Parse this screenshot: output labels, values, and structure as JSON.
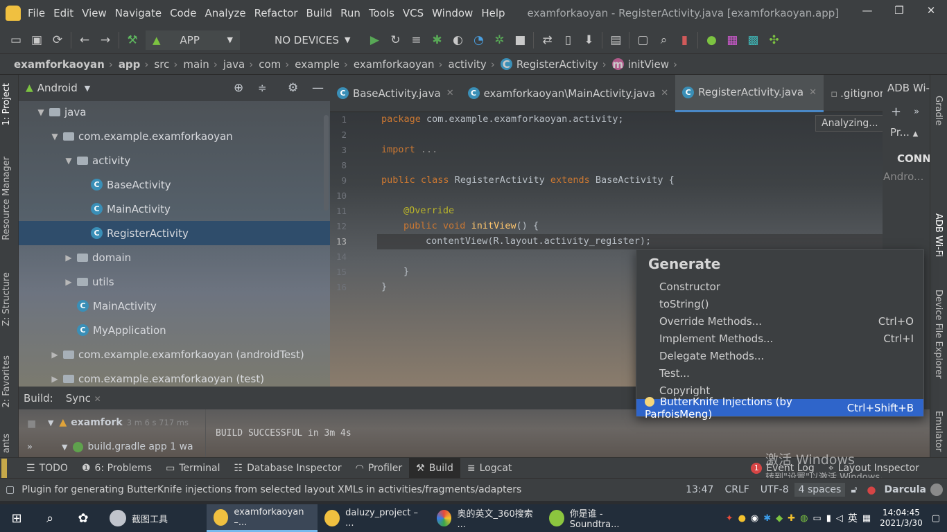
{
  "menu": [
    "File",
    "Edit",
    "View",
    "Navigate",
    "Code",
    "Analyze",
    "Refactor",
    "Build",
    "Run",
    "Tools",
    "VCS",
    "Window",
    "Help"
  ],
  "window_title": "examforkaoyan - RegisterActivity.java [examforkaoyan.app]",
  "toolbar": {
    "config": "APP",
    "devices": "NO DEVICES"
  },
  "breadcrumb": [
    "examforkaoyan",
    "app",
    "src",
    "main",
    "java",
    "com",
    "example",
    "examforkaoyan",
    "activity",
    "RegisterActivity",
    "initView"
  ],
  "left_tabs": [
    "1: Project",
    "Resource Manager",
    "Z: Structure",
    "2: Favorites",
    "ants"
  ],
  "right_tabs": [
    "Gradle",
    "ADB Wi-Fi",
    "Device File Explorer",
    "Emulator"
  ],
  "project": {
    "title": "Android",
    "rows": [
      "java",
      "com.example.examforkaoyan",
      "activity",
      "BaseActivity",
      "MainActivity",
      "RegisterActivity",
      "domain",
      "utils",
      "MainActivity",
      "MyApplication",
      "com.example.examforkaoyan (androidTest)",
      "com.example.examforkaoyan (test)"
    ]
  },
  "tabs": [
    "BaseActivity.java",
    "examforkaoyan\\MainActivity.java",
    "RegisterActivity.java",
    ".gitignore"
  ],
  "side_panel": {
    "title": "ADB Wi-",
    "btn": "Pr...",
    "conn": "CONN",
    "android": "Andro..."
  },
  "analyzing": "Analyzing...",
  "line_numbers": [
    "1",
    "2",
    "3",
    "8",
    "9",
    "10",
    "11",
    "12",
    "13",
    "14",
    "15",
    "16"
  ],
  "code": {
    "l1_kw": "package",
    "l1": " com.example.examforkaoyan.activity;",
    "l3_kw": "import",
    "l3": " ...",
    "l9_kw1": "public",
    "l9_kw2": "class",
    "l9_a": " RegisterActivity ",
    "l9_kw3": "extends",
    "l9_b": " BaseActivity {",
    "l11": "@Override",
    "l12_kw1": "public",
    "l12_kw2": "void",
    "l12_fn": "initView",
    "l12": "() {",
    "l13": "contentView(R.layout.activity_register);",
    "l15": "}",
    "l16": "}"
  },
  "popup": {
    "title": "Generate",
    "items": [
      {
        "label": "Constructor",
        "key": ""
      },
      {
        "label": "toString()",
        "key": ""
      },
      {
        "label": "Override Methods...",
        "key": "Ctrl+O"
      },
      {
        "label": "Implement Methods...",
        "key": "Ctrl+I"
      },
      {
        "label": "Delegate Methods...",
        "key": ""
      },
      {
        "label": "Test...",
        "key": ""
      },
      {
        "label": "Copyright",
        "key": ""
      },
      {
        "label": "ButterKnife Injections (by ParfoisMeng)",
        "key": "Ctrl+Shift+B"
      }
    ]
  },
  "build": {
    "label": "Build:",
    "sync": "Sync",
    "item1": "examfork",
    "item1_time": "3 m 6 s 717 ms",
    "item2": "build.gradle app 1 wa",
    "output": "BUILD SUCCESSFUL in 3m 4s"
  },
  "bottom_tabs": [
    "TODO",
    "6: Problems",
    "Terminal",
    "Database Inspector",
    "Profiler",
    "Build",
    "Logcat",
    "Event Log",
    "Layout Inspector"
  ],
  "event_badge": "1",
  "watermark": [
    "激活 Windows",
    "转到\"设置\"以激活 Windows。"
  ],
  "status": {
    "message": "Plugin for generating ButterKnife injections from selected layout XMLs in activities/fragments/adapters",
    "pos": "13:47",
    "crlf": "CRLF",
    "enc": "UTF-8",
    "indent": "4 spaces",
    "theme": "Darcula"
  },
  "taskbar": {
    "items": [
      "截图工具",
      "examforkaoyan –...",
      "daluzy_project – ...",
      "奥的英文_360搜索 ...",
      "你是谁 - Soundtra..."
    ],
    "ime": "英",
    "time": "14:04:45",
    "date": "2021/3/30"
  }
}
